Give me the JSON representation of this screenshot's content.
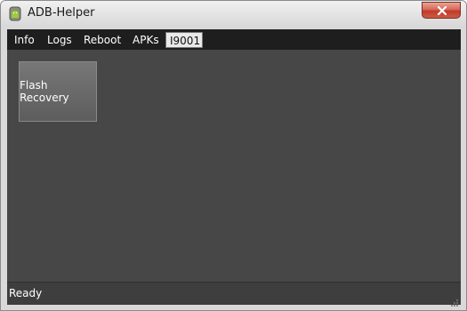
{
  "window": {
    "title": "ADB-Helper"
  },
  "menu": {
    "tabs": [
      {
        "label": "Info"
      },
      {
        "label": "Logs"
      },
      {
        "label": "Reboot"
      },
      {
        "label": "APKs"
      },
      {
        "label": "I9001",
        "selected": true
      }
    ]
  },
  "content": {
    "flash_recovery_label": "Flash Recovery"
  },
  "status": {
    "text": "Ready"
  },
  "icons": {
    "app": "android-icon",
    "close": "close-icon"
  },
  "colors": {
    "client_bg": "#474747",
    "menubar_bg": "#1e1e1e",
    "close_button": "#c23a27"
  }
}
